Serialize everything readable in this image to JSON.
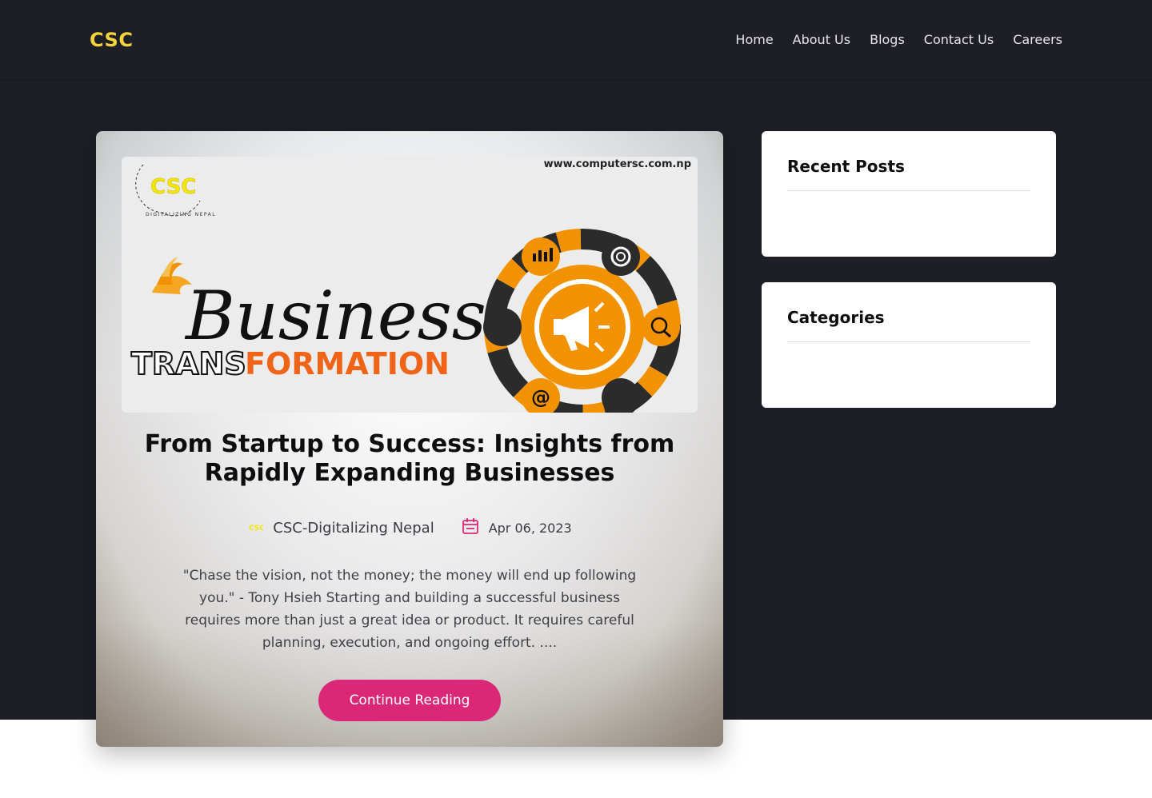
{
  "header": {
    "brand": "CSC",
    "nav": [
      "Home",
      "About Us",
      "Blogs",
      "Contact Us",
      "Careers"
    ]
  },
  "post": {
    "image": {
      "url_text": "www.computersc.com.np",
      "logo_text": "CSC",
      "logo_ring_text": "DIGITALIZING NEPAL",
      "headline_script": "Business",
      "headline_trans": "TRANS",
      "headline_formation": "FORMATION"
    },
    "title": "From Startup to Success: Insights from Rapidly Expanding Businesses",
    "author": "CSC-Digitalizing Nepal",
    "date": "Apr 06, 2023",
    "excerpt": "\"Chase the vision, not the money; the money will end up following you.\" - Tony Hsieh Starting and building a successful business requires more than just a great idea or product. It requires careful planning, execution, and ongoing effort. ....",
    "cta": "Continue Reading"
  },
  "sidebar": {
    "recent_title": "Recent Posts",
    "categories_title": "Categories"
  },
  "colors": {
    "background_dark": "#1e1e27",
    "brand_yellow": "#f5d33a",
    "accent_pink": "#db2777",
    "image_orange": "#f39200"
  },
  "icons": {
    "author": "csc-logo-icon",
    "date": "calendar-icon"
  }
}
